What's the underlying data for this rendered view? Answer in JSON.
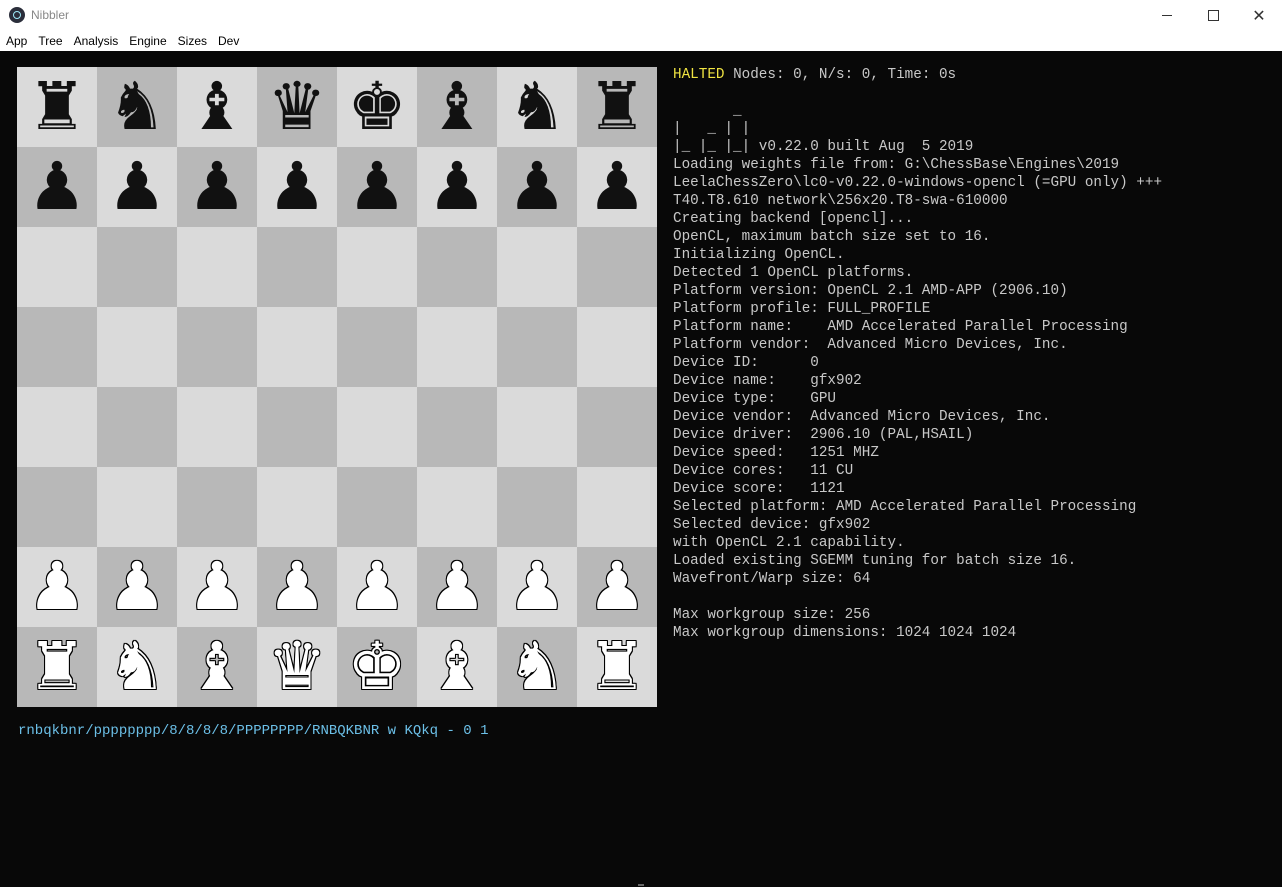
{
  "window": {
    "title": "Nibbler"
  },
  "menu": {
    "items": [
      "App",
      "Tree",
      "Analysis",
      "Engine",
      "Sizes",
      "Dev"
    ]
  },
  "board": {
    "rows": [
      [
        "♜",
        "♞",
        "♝",
        "♛",
        "♚",
        "♝",
        "♞",
        "♜"
      ],
      [
        "♟",
        "♟",
        "♟",
        "♟",
        "♟",
        "♟",
        "♟",
        "♟"
      ],
      [
        "",
        "",
        "",
        "",
        "",
        "",
        "",
        ""
      ],
      [
        "",
        "",
        "",
        "",
        "",
        "",
        "",
        ""
      ],
      [
        "",
        "",
        "",
        "",
        "",
        "",
        "",
        ""
      ],
      [
        "",
        "",
        "",
        "",
        "",
        "",
        "",
        ""
      ],
      [
        "♟",
        "♟",
        "♟",
        "♟",
        "♟",
        "♟",
        "♟",
        "♟"
      ],
      [
        "♜",
        "♞",
        "♝",
        "♛",
        "♚",
        "♝",
        "♞",
        "♜"
      ]
    ],
    "colors": [
      [
        "black",
        "black",
        "black",
        "black",
        "black",
        "black",
        "black",
        "black"
      ],
      [
        "black",
        "black",
        "black",
        "black",
        "black",
        "black",
        "black",
        "black"
      ],
      [
        "",
        "",
        "",
        "",
        "",
        "",
        "",
        ""
      ],
      [
        "",
        "",
        "",
        "",
        "",
        "",
        "",
        ""
      ],
      [
        "",
        "",
        "",
        "",
        "",
        "",
        "",
        ""
      ],
      [
        "",
        "",
        "",
        "",
        "",
        "",
        "",
        ""
      ],
      [
        "white",
        "white",
        "white",
        "white",
        "white",
        "white",
        "white",
        "white"
      ],
      [
        "white",
        "white",
        "white",
        "white",
        "white",
        "white",
        "white",
        "white"
      ]
    ]
  },
  "fen": "rnbqkbnr/pppppppp/8/8/8/8/PPPPPPPP/RNBQKBNR w KQkq - 0 1",
  "engine": {
    "status": "HALTED",
    "stats": " Nodes: 0, N/s: 0, Time: 0s",
    "log": [
      "       _",
      "|   _ | |",
      "|_ |_ |_| v0.22.0 built Aug  5 2019",
      "Loading weights file from: G:\\ChessBase\\Engines\\2019",
      "LeelaChessZero\\lc0-v0.22.0-windows-opencl (=GPU only) +++",
      "T40.T8.610 network\\256x20.T8-swa-610000",
      "Creating backend [opencl]...",
      "OpenCL, maximum batch size set to 16.",
      "Initializing OpenCL.",
      "Detected 1 OpenCL platforms.",
      "Platform version: OpenCL 2.1 AMD-APP (2906.10)",
      "Platform profile: FULL_PROFILE",
      "Platform name:    AMD Accelerated Parallel Processing",
      "Platform vendor:  Advanced Micro Devices, Inc.",
      "Device ID:      0",
      "Device name:    gfx902",
      "Device type:    GPU",
      "Device vendor:  Advanced Micro Devices, Inc.",
      "Device driver:  2906.10 (PAL,HSAIL)",
      "Device speed:   1251 MHZ",
      "Device cores:   11 CU",
      "Device score:   1121",
      "Selected platform: AMD Accelerated Parallel Processing",
      "Selected device: gfx902",
      "with OpenCL 2.1 capability.",
      "Loaded existing SGEMM tuning for batch size 16.",
      "Wavefront/Warp size: 64",
      "",
      "Max workgroup size: 256",
      "Max workgroup dimensions: 1024 1024 1024"
    ]
  },
  "colors": {
    "background": "#080808",
    "halted": "#f0e442",
    "fen": "#6cc0e8",
    "text": "#c8c8c8",
    "light_square": "#dadada",
    "dark_square": "#b8b8b8"
  }
}
